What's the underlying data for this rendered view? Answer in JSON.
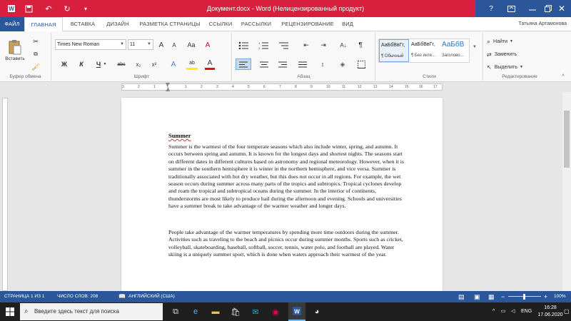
{
  "titlebar": {
    "title": "Документ.docx - Word (Нелицензированный продукт)",
    "help": "?",
    "icons": [
      "word-icon",
      "save-icon",
      "undo-icon",
      "redo-icon",
      "customize-icon",
      "ribbon-display-icon",
      "minimize-icon",
      "restore-icon",
      "close-icon"
    ]
  },
  "tabs": [
    "ФАЙЛ",
    "ГЛАВНАЯ",
    "ВСТАВКА",
    "ДИЗАЙН",
    "РАЗМЕТКА СТРАНИЦЫ",
    "ССЫЛКИ",
    "РАССЫЛКИ",
    "РЕЦЕНЗИРОВАНИЕ",
    "ВИД"
  ],
  "active_tab": "ГЛАВНАЯ",
  "user_name": "Татьяна Артамонова",
  "ribbon": {
    "clipboard": {
      "paste_label": "Вставить",
      "group_label": "Буфер обмена"
    },
    "font": {
      "font_name": "Times New Roman",
      "font_size": "11",
      "bold": "Ж",
      "italic": "К",
      "underline": "Ч",
      "strike": "abc",
      "subscript": "x₂",
      "superscript": "x²",
      "grow": "A",
      "shrink": "A",
      "case": "Aa",
      "clear": "A",
      "highlight": "ab",
      "color": "A",
      "group_label": "Шрифт"
    },
    "paragraph": {
      "group_label": "Абзац"
    },
    "styles": {
      "items": [
        {
          "sample": "АаБбВвГг,",
          "name": "¶ Обычный"
        },
        {
          "sample": "АаБбВвГг,",
          "name": "¶ Без инте..."
        },
        {
          "sample": "АаБбВ",
          "name": "Заголово..."
        }
      ],
      "group_label": "Стили"
    },
    "editing": {
      "find": "Найти",
      "replace": "Заменить",
      "select": "Выделить",
      "group_label": "Редактирование"
    }
  },
  "ruler": {
    "numbers": [
      "3",
      "2",
      "1",
      "1",
      "2",
      "3",
      "4",
      "5",
      "6",
      "7",
      "8",
      "9",
      "10",
      "11",
      "12",
      "13",
      "14",
      "15",
      "16",
      "17"
    ]
  },
  "document": {
    "heading": "Summer",
    "paragraph1": [
      "Summer is the warmest of the four temperate seasons which also include winter, spring, and autumn. It",
      "occurs between spring and autumn. It is known for the longest days and shortest nights. The seasons start",
      "on different dates in different cultures based on astronomy and regional meteorology. However, when it is",
      "summer in the southern hemisphere it is winter in the northern hemisphere, and vice versa. Summer is",
      "traditionally associated with hot dry weather, but this does not occur in all regions. For example, the wet",
      "season occurs during summer across many parts of the tropics and subtropics. Tropical cyclones develop",
      "and roam the tropical and subtropical oceans during the summer. In the interior of continents,",
      "thunderstorms are most likely to produce hail during the afternoon and evening. Schools and universities",
      "have a summer break to take advantage of the warmer weather and longer days."
    ],
    "paragraph2": [
      "People take advantage of the warmer temperatures by spending more time outdoors during the summer.",
      "Activities such as traveling to the beach and picnics occur during summer months. Sports such as cricket,",
      "volleyball, skateboarding, baseball, softball, soccer, tennis, water polo, and football are played. Water",
      "skiing is a uniquely summer sport, which is done when waters approach their warmest of the year."
    ]
  },
  "statusbar": {
    "page": "СТРАНИЦА 1 ИЗ 1",
    "words": "ЧИСЛО СЛОВ: 208",
    "language": "АНГЛИЙСКИЙ (США)",
    "zoom_minus": "−",
    "zoom_plus": "+",
    "zoom": "100%"
  },
  "taskbar": {
    "search_placeholder": "Введите здесь текст для поиска",
    "lang": "ENG",
    "time": "16:28",
    "date": "17.06.2020"
  },
  "colors": {
    "word_blue": "#2b579a",
    "title_red": "#d8203e",
    "taskbar": "#1f1f1f"
  }
}
